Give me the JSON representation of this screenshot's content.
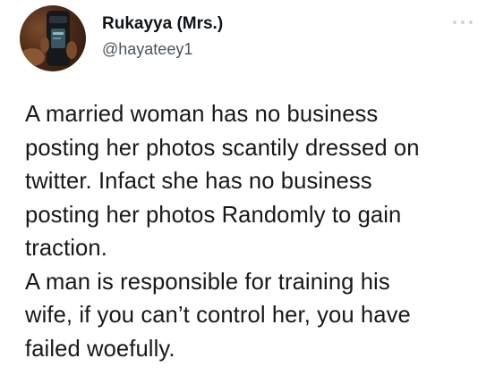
{
  "tweet": {
    "author": {
      "display_name": "Rukayya (Mrs.)",
      "handle": "@hayateey1",
      "avatar_icon": "profile-photo"
    },
    "more_icon": "more-dots-icon",
    "text_paragraphs": [
      "A married woman has no business\nposting her photos scantily dressed on\ntwitter. Infact she has no business\nposting her photos Randomly to gain\ntraction.",
      "A man is responsible for training his\nwife, if you can’t control her, you have\nfailed woefully."
    ]
  },
  "colors": {
    "text": "#0f1419",
    "secondary_text": "#536471",
    "background": "#ffffff"
  }
}
